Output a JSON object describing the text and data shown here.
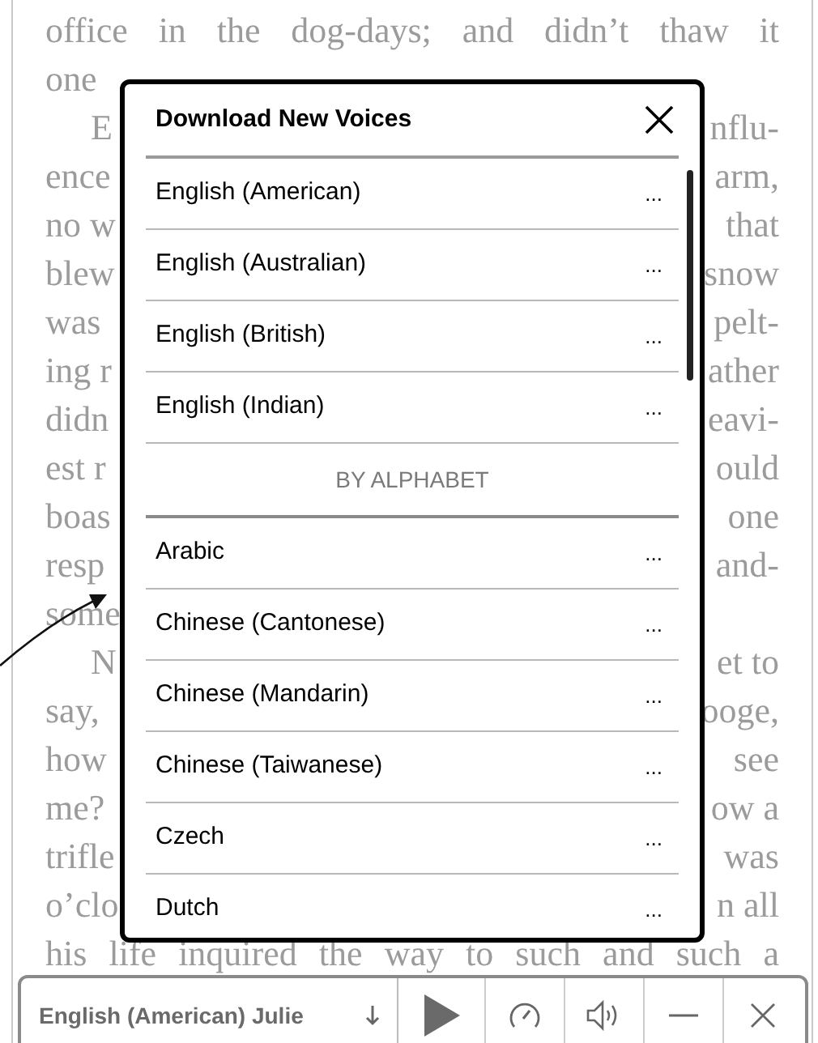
{
  "book": {
    "lines": [
      {
        "kind": "full",
        "left": "office in the dog-days; and didn’t thaw it",
        "indented": false
      },
      {
        "kind": "split",
        "left": "one",
        "indented": false
      },
      {
        "kind": "split",
        "left": "E",
        "right": "nflu-",
        "indented": true
      },
      {
        "kind": "split",
        "left": "ence",
        "right": "arm,",
        "indented": false
      },
      {
        "kind": "split",
        "left": "no w",
        "right": "that",
        "indented": false
      },
      {
        "kind": "split",
        "left": "blew",
        "right": "snow",
        "indented": false
      },
      {
        "kind": "split",
        "left": "was",
        "right": "pelt-",
        "indented": false
      },
      {
        "kind": "split",
        "left": "ing r",
        "right": "ather",
        "indented": false
      },
      {
        "kind": "split",
        "left": "didn",
        "right": "eavi-",
        "indented": false
      },
      {
        "kind": "split",
        "left": "est r",
        "right": "ould",
        "indented": false
      },
      {
        "kind": "split",
        "left": "boas",
        "right": "one",
        "indented": false
      },
      {
        "kind": "split",
        "left": "resp",
        "right": "and-",
        "indented": false
      },
      {
        "kind": "split",
        "left": "some",
        "indented": false
      },
      {
        "kind": "split",
        "left": "N",
        "right": "et to",
        "indented": true
      },
      {
        "kind": "split",
        "left": "say,",
        "right": "ooge,",
        "indented": false
      },
      {
        "kind": "split",
        "left": "how",
        "right": "see",
        "indented": false
      },
      {
        "kind": "split",
        "left": "me?",
        "right": "ow a",
        "indented": false
      },
      {
        "kind": "split",
        "left": "trifle",
        "right": "was",
        "indented": false
      },
      {
        "kind": "split",
        "left": "o’clo",
        "right": "n all",
        "indented": false
      },
      {
        "kind": "full",
        "left": "his life inquired the way to such and such a",
        "indented": false
      }
    ]
  },
  "dialog": {
    "title": "Download New Voices",
    "featured": [
      {
        "name": "English (American)",
        "menu": "..."
      },
      {
        "name": "English (Australian)",
        "menu": "..."
      },
      {
        "name": "English (British)",
        "menu": "..."
      },
      {
        "name": "English (Indian)",
        "menu": "..."
      }
    ],
    "section_header": "BY ALPHABET",
    "voices": [
      {
        "name": "Arabic",
        "menu": "..."
      },
      {
        "name": "Chinese (Cantonese)",
        "menu": "..."
      },
      {
        "name": "Chinese (Mandarin)",
        "menu": "..."
      },
      {
        "name": "Chinese (Taiwanese)",
        "menu": "..."
      },
      {
        "name": "Czech",
        "menu": "..."
      },
      {
        "name": "Dutch",
        "menu": "..."
      }
    ]
  },
  "player": {
    "voice": "English (American) Julie"
  }
}
